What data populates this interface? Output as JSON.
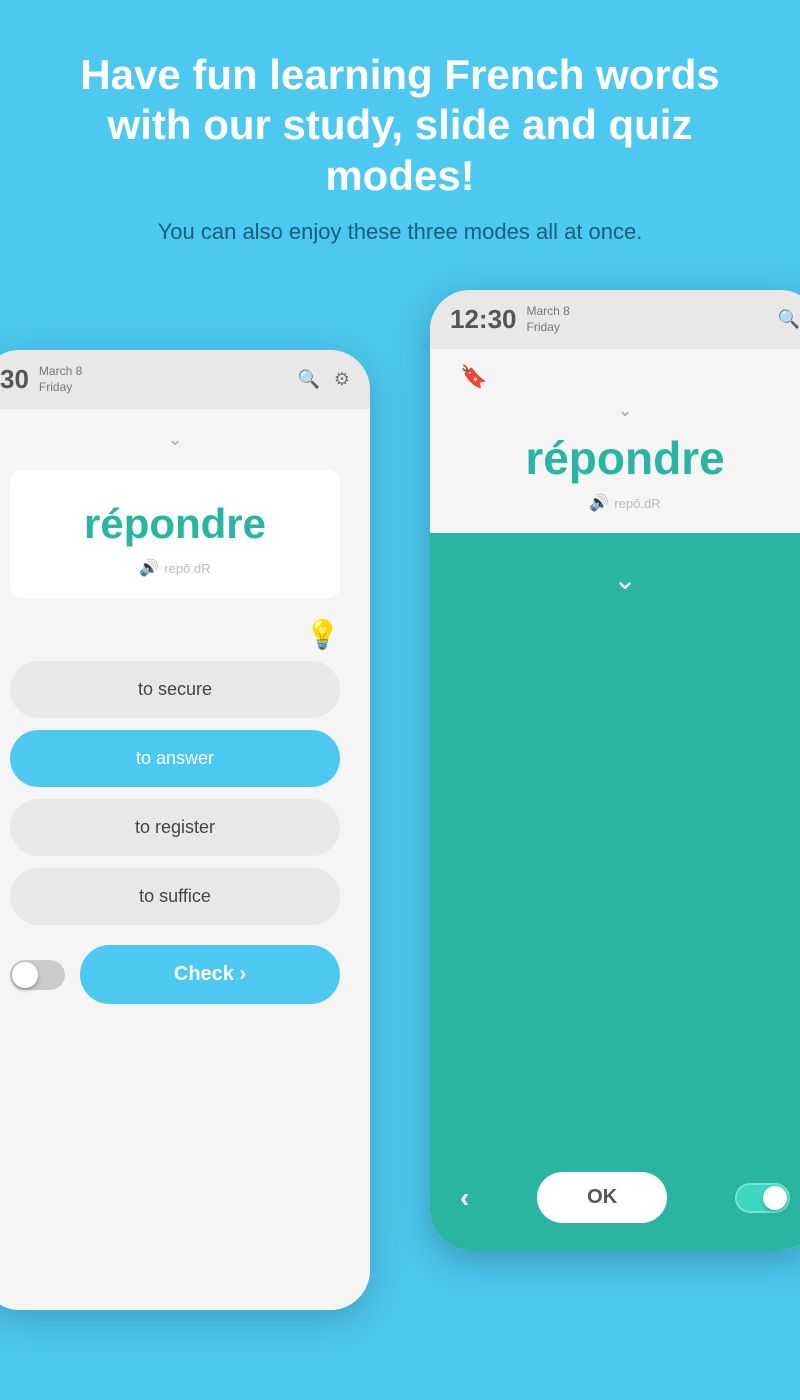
{
  "header": {
    "main_title": "Have fun learning French words with our study, slide and quiz modes!",
    "sub_title": "You can also enjoy these three modes all at once."
  },
  "phone_left": {
    "status_time": "30",
    "status_date_month": "March 8",
    "status_date_day": "Friday",
    "french_word": "répondre",
    "pronunciation": "repō.dR",
    "hint_emoji": "💡",
    "options": [
      {
        "label": "to secure",
        "selected": false
      },
      {
        "label": "to answer",
        "selected": true
      },
      {
        "label": "to register",
        "selected": false
      },
      {
        "label": "to suffice",
        "selected": false
      }
    ],
    "check_button": "Check ›"
  },
  "phone_right": {
    "status_time": "12:30",
    "status_date_month": "March 8",
    "status_date_day": "Friday",
    "french_word": "répondre",
    "pronunciation": "repō.dR",
    "ok_button": "OK",
    "chevron": "›"
  },
  "icons": {
    "search": "🔍",
    "settings": "⚙",
    "sound": "🔊",
    "bookmark": "🔖",
    "chevron_down": "⌄",
    "back_arrow": "‹"
  }
}
